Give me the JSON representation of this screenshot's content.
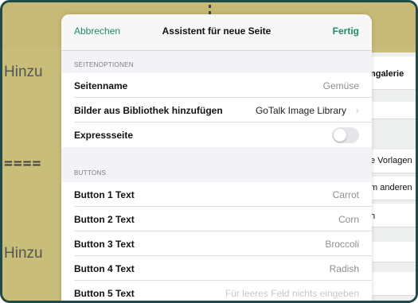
{
  "background": {
    "hinzu_top": "Hinzu",
    "hinzu_bottom": "Hinzu",
    "dashes": "====",
    "right_rows": [
      "ngalerie",
      "e Vorlagen",
      "m anderen",
      "h"
    ]
  },
  "nav": {
    "cancel": "Abbrechen",
    "title": "Assistent für neue Seite",
    "done": "Fertig"
  },
  "sections": {
    "page_options": "SEITENOPTIONEN",
    "buttons": "BUTTONS"
  },
  "page_options": {
    "page_name_label": "Seitenname",
    "page_name_value": "Gemüse",
    "library_label": "Bilder aus Bibliothek hinzufügen",
    "library_value": "GoTalk Image Library",
    "express_label": "Expressseite",
    "express_on": false
  },
  "buttons": [
    {
      "label": "Button 1 Text",
      "value": "Carrot"
    },
    {
      "label": "Button 2 Text",
      "value": "Corn"
    },
    {
      "label": "Button 3 Text",
      "value": "Broccoli"
    },
    {
      "label": "Button 4 Text",
      "value": "Radish"
    },
    {
      "label": "Button 5 Text",
      "placeholder": "Für leeres Feld nichts eingeben"
    }
  ],
  "icons": {
    "chevron": "chevron-right-icon"
  }
}
